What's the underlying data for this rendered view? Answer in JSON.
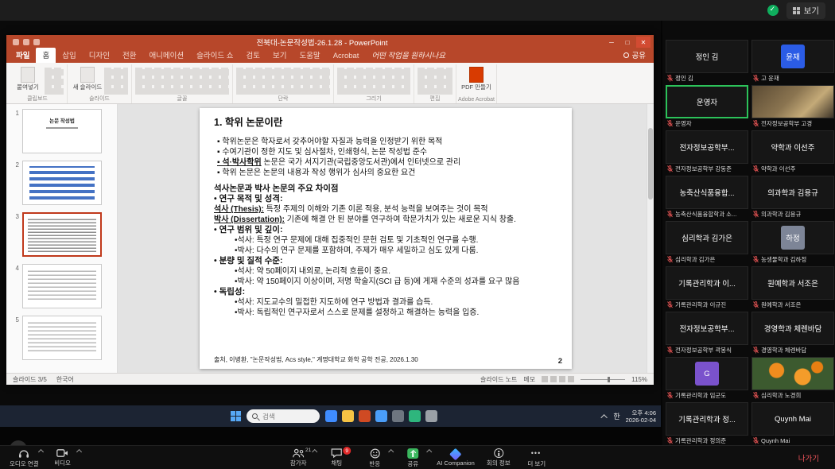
{
  "top_bar": {
    "view_label": "보기"
  },
  "ppt": {
    "window_title": "전북대-논문작성법-26.1.28 - PowerPoint",
    "share_button": "공유",
    "tabs": [
      {
        "label": "파일",
        "cls": "tab-file"
      },
      {
        "label": "홈",
        "cls": "tab-active"
      },
      {
        "label": "삽입",
        "cls": ""
      },
      {
        "label": "디자인",
        "cls": ""
      },
      {
        "label": "전환",
        "cls": ""
      },
      {
        "label": "애니메이션",
        "cls": ""
      },
      {
        "label": "슬라이드 쇼",
        "cls": ""
      },
      {
        "label": "검토",
        "cls": ""
      },
      {
        "label": "보기",
        "cls": ""
      },
      {
        "label": "도움말",
        "cls": ""
      },
      {
        "label": "Acrobat",
        "cls": ""
      },
      {
        "label": "어떤 작업을 원하시나요",
        "cls": "tab-tellme"
      }
    ],
    "ribbon_groups": [
      {
        "label": "클립보드",
        "big": "붙여넣기",
        "cls": "g-clip"
      },
      {
        "label": "슬라이드",
        "big": "새 슬라이드",
        "cls": "g-slide"
      },
      {
        "label": "글꼴",
        "big": "",
        "cls": "g-font nobig"
      },
      {
        "label": "단락",
        "big": "",
        "cls": "g-para nobig"
      },
      {
        "label": "그리기",
        "big": "",
        "cls": "g-draw nobig"
      },
      {
        "label": "편집",
        "big": "",
        "cls": "g-edit nobig"
      },
      {
        "label": "Adobe Acrobat",
        "big": "PDF 만들기",
        "cls": "g-pdf"
      }
    ],
    "thumbnails": [
      {
        "num": "1",
        "cls": "thumb-title",
        "text": "논문 작성법"
      },
      {
        "num": "2",
        "cls": "thumb-toc",
        "text": ""
      },
      {
        "num": "3",
        "cls": "thumb-dense sel",
        "text": ""
      },
      {
        "num": "4",
        "cls": "thumb-text",
        "text": ""
      },
      {
        "num": "5",
        "cls": "thumb-text",
        "text": ""
      }
    ],
    "slide": {
      "lines": [
        {
          "cls": "s-title",
          "lead": "",
          "rest": "1. 학위 논문이란"
        },
        {
          "cls": "s-gap",
          "lead": "",
          "rest": ""
        },
        {
          "cls": "s-bullet",
          "lead": "",
          "rest": "▪ 학위논문은 학자로서 갖추어야할 자질과 능력을 인정받기 위한 목적"
        },
        {
          "cls": "s-bullet",
          "lead": "",
          "rest": "▪ 수여기관이 정한 지도 및 심사절차, 인쇄형식, 논문 작성법 준수"
        },
        {
          "cls": "s-bullet",
          "lead": "▪ 석·박사학위",
          "rest": " 논문은 국가 서지기관(국립중앙도서관)에서 인터넷으로 관리"
        },
        {
          "cls": "s-bullet",
          "lead": "",
          "rest": "▪ 학위 논문은 논문의 내용과 작성 행위가 심사의 중요한 요건"
        },
        {
          "cls": "s-gap",
          "lead": "",
          "rest": ""
        },
        {
          "cls": "s-h",
          "lead": "",
          "rest": "석사논문과 박사 논문의 주요 차이점"
        },
        {
          "cls": "s-h",
          "lead": "",
          "rest": "• 연구 목적 및 성격:"
        },
        {
          "cls": "s-body",
          "lead": "석사 (Thesis):",
          "rest": " 특정 주제의 이해와 기존 이론 적용, 분석 능력을 보여주는 것이 목적"
        },
        {
          "cls": "s-body",
          "lead": "박사 (Dissertation):",
          "rest": " 기존에 해결 안 된 분야를 연구하여 학문가치가 있는 새로운 지식 창출."
        },
        {
          "cls": "s-h",
          "lead": "",
          "rest": "• 연구 범위 및 깊이:"
        },
        {
          "cls": "s-sub",
          "lead": "",
          "rest": "•석사: 특정 연구 문제에 대해 집중적인 문헌 검토 및 기초적인 연구를 수행."
        },
        {
          "cls": "s-sub",
          "lead": "",
          "rest": "•박사: 다수의 연구 문제를 포함하며, 주제가 매우 세밀하고 심도 있게 다룸."
        },
        {
          "cls": "s-h",
          "lead": "",
          "rest": "• 분량 및 질적 수준:"
        },
        {
          "cls": "s-sub",
          "lead": "",
          "rest": "•석사: 약 50페이지 내외로, 논리적 흐름이 중요."
        },
        {
          "cls": "s-sub",
          "lead": "",
          "rest": "•박사: 약 150페이지 이상이며, 저명 학술지(SCI 급 등)에 게재 수준의 성과를 요구 많음"
        },
        {
          "cls": "s-h",
          "lead": "",
          "rest": "• 독립성:"
        },
        {
          "cls": "s-sub",
          "lead": "",
          "rest": "•석사: 지도교수의 밀접한 지도하에 연구 방법과 결과를 습득."
        },
        {
          "cls": "s-sub",
          "lead": "",
          "rest": "•박사: 독립적인 연구자로서 스스로 문제를 설정하고 해결하는 능력을 입증."
        }
      ],
      "source": "출처, 이병환, \"논문작성법, Acs style,\" 계명대학교 화학 공학 전공, 2026.1.30",
      "page": "2"
    },
    "status": {
      "slide_indicator": "슬라이드 3/5",
      "language": "한국어",
      "notes": "슬라이드 노트",
      "memo": "메모",
      "zoom": "115%"
    }
  },
  "taskbar": {
    "search_placeholder": "검색",
    "icons": [
      {
        "name": "edge-icon",
        "cls": "ic1"
      },
      {
        "name": "folder-icon",
        "cls": "ic2"
      },
      {
        "name": "powerpoint-icon",
        "cls": "ic3"
      },
      {
        "name": "zoom-icon",
        "cls": "ic4"
      },
      {
        "name": "settings-icon",
        "cls": "ic5"
      },
      {
        "name": "excel-icon",
        "cls": "ic6"
      },
      {
        "name": "app-icon",
        "cls": "ic7"
      }
    ],
    "lang": "한",
    "time": "오후 4:06",
    "date": "2026-02-04"
  },
  "participants": [
    {
      "display": "정인 김",
      "label": "정인 김",
      "cls": "t-name"
    },
    {
      "display": "윤재",
      "label": "고 윤재",
      "cls": "t-avatar av-blue"
    },
    {
      "display": "운영자",
      "label": "운영자",
      "cls": "t-name active"
    },
    {
      "display": "",
      "label": "전자정보공학부 고경",
      "cls": "t-photo ph-fig"
    },
    {
      "display": "전자정보공학부...",
      "label": "전자정보공학부 강동준",
      "cls": "t-name"
    },
    {
      "display": "약학과 이선주",
      "label": "약학과 이선주",
      "cls": "t-name"
    },
    {
      "display": "농축산식품융합...",
      "label": "농축산식품융합학과 소...",
      "cls": "t-name"
    },
    {
      "display": "의과학과 김용규",
      "label": "의과학과 김용규",
      "cls": "t-name"
    },
    {
      "display": "심리학과 김가은",
      "label": "심리학과 김가은",
      "cls": "t-name"
    },
    {
      "display": "하정",
      "label": "농생물학과 김하정",
      "cls": "t-avatar av-gray"
    },
    {
      "display": "기록관리학과 이...",
      "label": "기록관리학과 이규진",
      "cls": "t-name"
    },
    {
      "display": "원예학과 서조은",
      "label": "원예학과 서조은",
      "cls": "t-name"
    },
    {
      "display": "전자정보공학부...",
      "label": "전자정보공학부 곽봉식",
      "cls": "t-name"
    },
    {
      "display": "경영학과 체렌바담",
      "label": "경영학과 체렌바담",
      "cls": "t-name"
    },
    {
      "display": "G",
      "label": "기록관리학과 임군도",
      "cls": "t-avatar av-purple"
    },
    {
      "display": "",
      "label": "심리학과 노경희",
      "cls": "t-photo ph-orange"
    },
    {
      "display": "기록관리학과 정...",
      "label": "기록관리학과 정의준",
      "cls": "t-name"
    },
    {
      "display": "Quynh Mai",
      "label": "Quynh Mai",
      "cls": "t-name"
    }
  ],
  "toolbar": {
    "audio": {
      "label": "오디오 연결"
    },
    "video": {
      "label": "비디오"
    },
    "participants": {
      "label": "참가자",
      "count": "21"
    },
    "chat": {
      "label": "채팅",
      "badge": "9"
    },
    "reactions": {
      "label": "반응"
    },
    "share": {
      "label": "공유"
    },
    "ai": {
      "label": "AI Companion"
    },
    "info": {
      "label": "회의 정보"
    },
    "more": {
      "label": "더 보기"
    },
    "leave": {
      "label": "나가기"
    }
  }
}
